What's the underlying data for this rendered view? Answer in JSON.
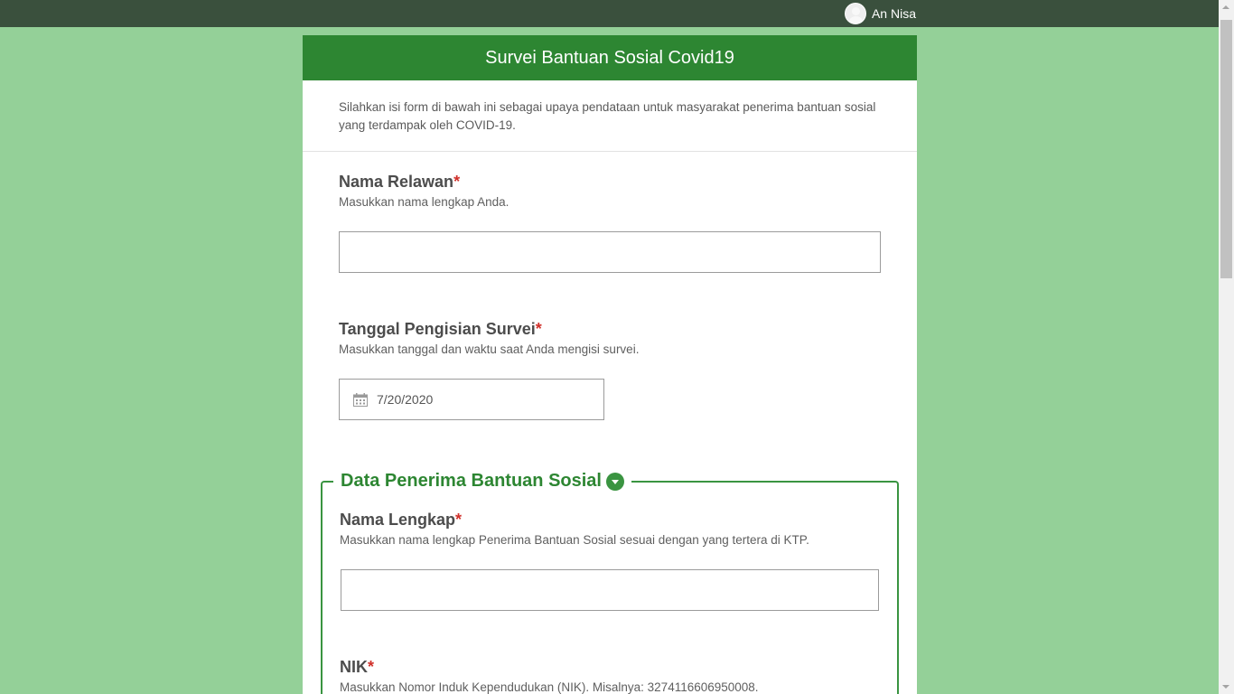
{
  "user": {
    "name": "An Nisa"
  },
  "survey": {
    "title": "Survei Bantuan Sosial Covid19",
    "description": "Silahkan isi form di bawah ini sebagai upaya pendataan untuk masyarakat penerima bantuan sosial yang terdampak oleh COVID-19."
  },
  "questions": {
    "relawan": {
      "label": "Nama Relawan",
      "required": "*",
      "hint": "Masukkan nama lengkap Anda.",
      "value": ""
    },
    "tanggal": {
      "label": "Tanggal Pengisian Survei",
      "required": "*",
      "hint": "Masukkan tanggal dan waktu saat Anda mengisi survei.",
      "value": "7/20/2020"
    }
  },
  "group": {
    "title": "Data Penerima Bantuan Sosial",
    "nama": {
      "label": "Nama Lengkap",
      "required": "*",
      "hint": "Masukkan nama lengkap Penerima Bantuan Sosial sesuai dengan yang tertera di KTP.",
      "value": ""
    },
    "nik": {
      "label": "NIK",
      "required": "*",
      "hint": "Masukkan Nomor Induk Kependudukan (NIK). Misalnya: 3274116606950008."
    }
  },
  "icons": {
    "avatar": "user-avatar-icon",
    "calendar": "calendar-icon",
    "collapse": "chevron-down-icon"
  },
  "colors": {
    "topbar": "#3a503d",
    "background": "#94d098",
    "header": "#2d8632",
    "accent": "#3a9441",
    "required": "#d0302a"
  }
}
